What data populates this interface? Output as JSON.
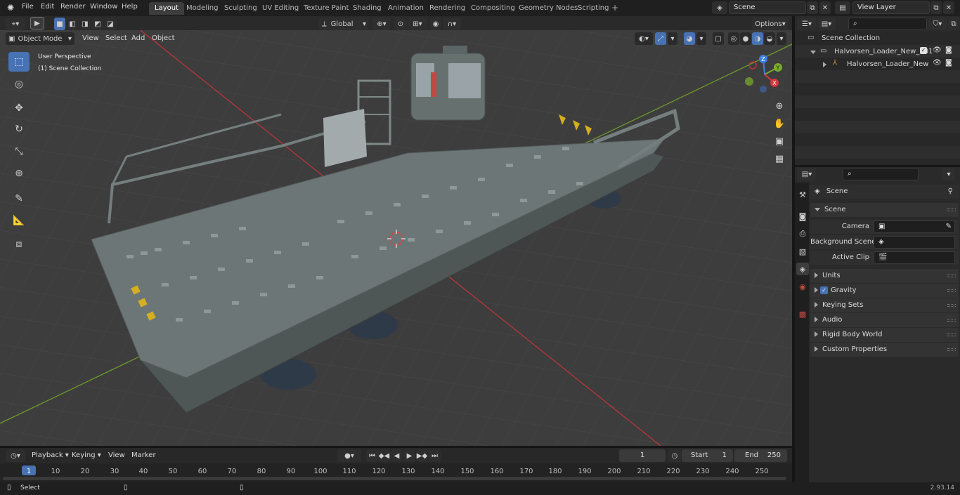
{
  "topbar": {
    "menus": [
      "File",
      "Edit",
      "Render",
      "Window",
      "Help"
    ],
    "workspaces": [
      "Layout",
      "Modeling",
      "Sculpting",
      "UV Editing",
      "Texture Paint",
      "Shading",
      "Animation",
      "Rendering",
      "Compositing",
      "Geometry Nodes",
      "Scripting"
    ],
    "active_workspace": "Layout",
    "scene_name": "Scene",
    "view_layer": "View Layer"
  },
  "viewport_header": {
    "mode": "Object Mode",
    "menus": [
      "View",
      "Select",
      "Add",
      "Object"
    ],
    "orientation": "Global",
    "options_label": "Options"
  },
  "viewport": {
    "view_name": "User Perspective",
    "collection_label": "(1) Scene Collection"
  },
  "gizmo": {
    "x": "X",
    "y": "Y",
    "z": "Z"
  },
  "outliner": {
    "root": "Scene Collection",
    "items": [
      {
        "label": "Halvorsen_Loader_New_001",
        "level": 1,
        "expanded": true
      },
      {
        "label": "Halvorsen_Loader_New",
        "level": 2,
        "expanded": false
      }
    ]
  },
  "properties": {
    "header": "Scene",
    "section": "Scene",
    "fields": [
      {
        "label": "Camera",
        "value": ""
      },
      {
        "label": "Background Scene",
        "value": ""
      },
      {
        "label": "Active Clip",
        "value": ""
      }
    ],
    "panels": [
      "Units",
      "Gravity",
      "Keying Sets",
      "Audio",
      "Rigid Body World",
      "Custom Properties"
    ],
    "gravity_checked": true
  },
  "timeline": {
    "menus": [
      "Playback",
      "Keying",
      "View",
      "Marker"
    ],
    "current_frame": "1",
    "start_label": "Start",
    "start": "1",
    "end_label": "End",
    "end": "250",
    "ticks": [
      "1",
      "10",
      "20",
      "30",
      "40",
      "50",
      "60",
      "70",
      "80",
      "90",
      "100",
      "110",
      "120",
      "130",
      "140",
      "150",
      "160",
      "170",
      "180",
      "190",
      "200",
      "210",
      "220",
      "230",
      "240",
      "250"
    ]
  },
  "statusbar": {
    "left": "Select",
    "version": "2.93.14"
  },
  "colors": {
    "accent": "#4772b3",
    "x_axis": "#d7363f",
    "y_axis": "#7aae2a",
    "z_axis": "#3f7fe0"
  }
}
